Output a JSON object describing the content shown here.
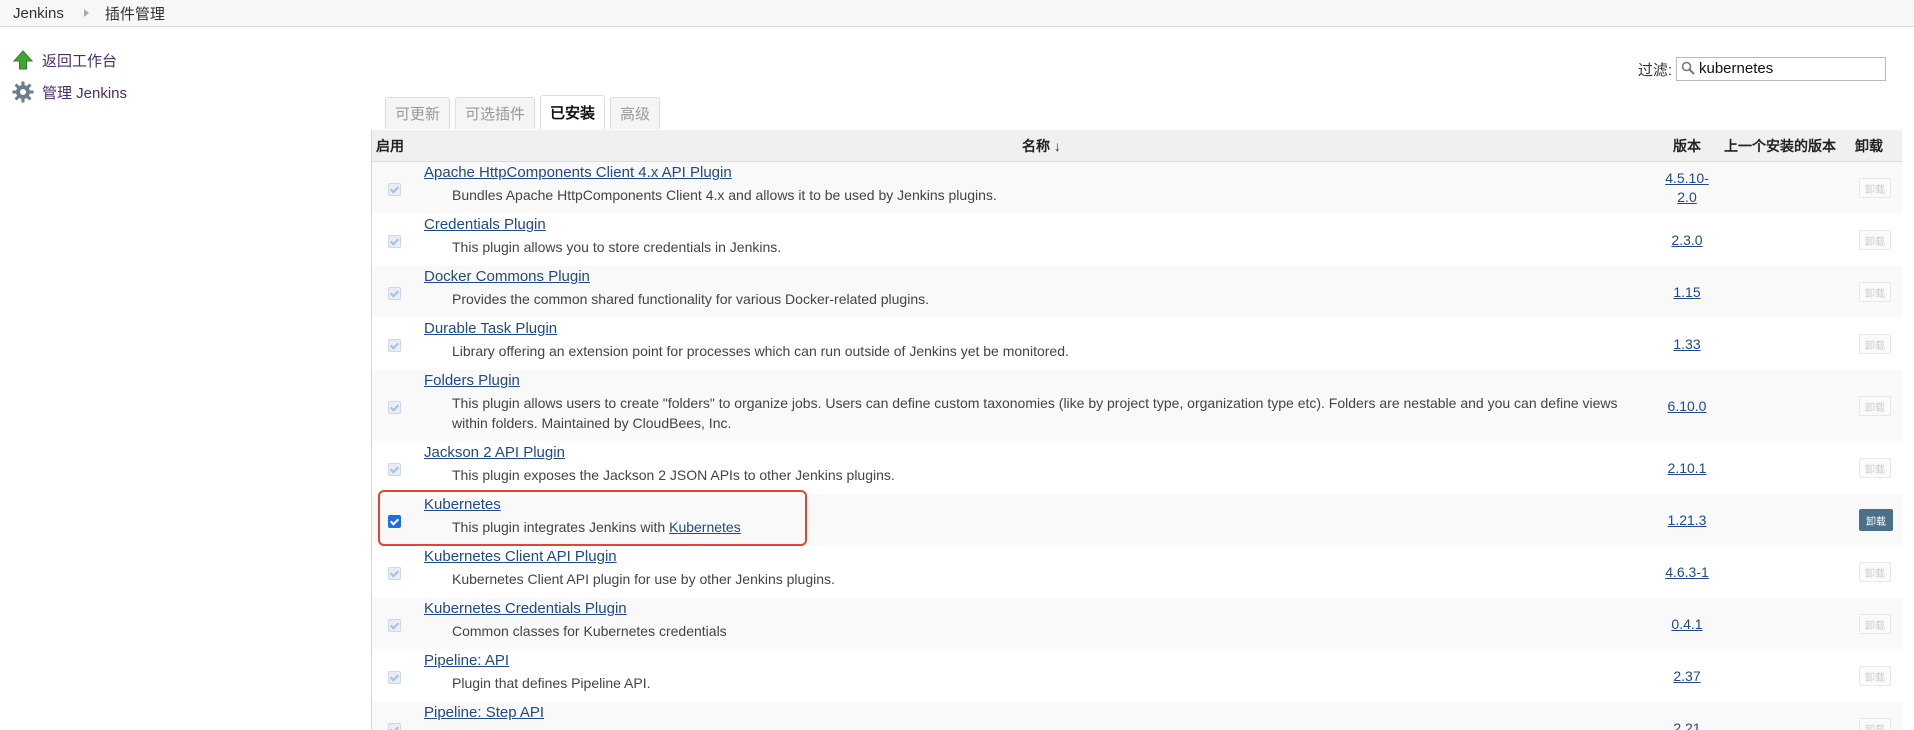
{
  "breadcrumb": [
    "Jenkins",
    "插件管理"
  ],
  "sidebar": [
    {
      "label": "返回工作台",
      "icon": "up-arrow-icon"
    },
    {
      "label": "管理 Jenkins",
      "icon": "gear-icon"
    }
  ],
  "filter": {
    "label": "过滤:",
    "value": "kubernetes"
  },
  "tabs": [
    {
      "label": "可更新",
      "active": false
    },
    {
      "label": "可选插件",
      "active": false
    },
    {
      "label": "已安装",
      "active": true
    },
    {
      "label": "高级",
      "active": false
    }
  ],
  "table": {
    "headers": {
      "enable": "启用",
      "name": "名称 ↓",
      "version": "版本",
      "prev": "上一个安装的版本",
      "uninstall": "卸载"
    },
    "uninstall_label": "卸载",
    "rows": [
      {
        "name": "Apache HttpComponents Client 4.x API Plugin",
        "desc": "Bundles Apache HttpComponents Client 4.x and allows it to be used by Jenkins plugins.",
        "version": "4.5.10-2.0",
        "enabled": false
      },
      {
        "name": "Credentials Plugin",
        "desc": "This plugin allows you to store credentials in Jenkins.",
        "version": "2.3.0",
        "enabled": false
      },
      {
        "name": "Docker Commons Plugin",
        "desc": "Provides the common shared functionality for various Docker-related plugins.",
        "version": "1.15",
        "enabled": false
      },
      {
        "name": "Durable Task Plugin",
        "desc": "Library offering an extension point for processes which can run outside of Jenkins yet be monitored.",
        "version": "1.33",
        "enabled": false
      },
      {
        "name": "Folders Plugin",
        "desc": "This plugin allows users to create \"folders\" to organize jobs. Users can define custom taxonomies (like by project type, organization type etc). Folders are nestable and you can define views within folders. Maintained by CloudBees, Inc.",
        "version": "6.10.0",
        "enabled": false
      },
      {
        "name": "Jackson 2 API Plugin",
        "desc": "This plugin exposes the Jackson 2 JSON APIs to other Jenkins plugins.",
        "version": "2.10.1",
        "enabled": false
      },
      {
        "name": "Kubernetes",
        "desc": "This plugin integrates Jenkins with ",
        "desc_link": "Kubernetes",
        "version": "1.21.3",
        "enabled": true
      },
      {
        "name": "Kubernetes Client API Plugin",
        "desc": "Kubernetes Client API plugin for use by other Jenkins plugins.",
        "version": "4.6.3-1",
        "enabled": false
      },
      {
        "name": "Kubernetes Credentials Plugin",
        "desc": "Common classes for Kubernetes credentials",
        "version": "0.4.1",
        "enabled": false
      },
      {
        "name": "Pipeline: API",
        "desc": "Plugin that defines Pipeline API.",
        "version": "2.37",
        "enabled": false
      },
      {
        "name": "Pipeline: Step API",
        "desc": "",
        "version": "2.21",
        "enabled": false
      }
    ]
  }
}
